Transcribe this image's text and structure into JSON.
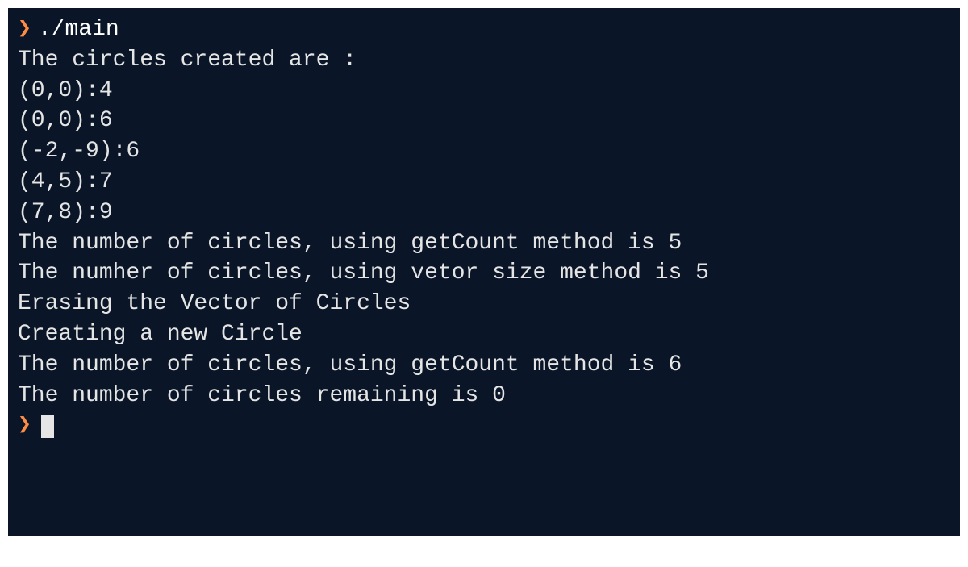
{
  "terminal": {
    "prompt_symbol": "❯",
    "command": "./main",
    "output": [
      "The circles created are :",
      "(0,0):4",
      "(0,0):6",
      "(-2,-9):6",
      "(4,5):7",
      "(7,8):9",
      "The number of circles, using getCount method is 5",
      "The numher of circles, using vetor size method is 5",
      "Erasing the Vector of Circles",
      "Creating a new Circle",
      "The number of circles, using getCount method is 6",
      "The number of circles remaining is 0"
    ]
  }
}
